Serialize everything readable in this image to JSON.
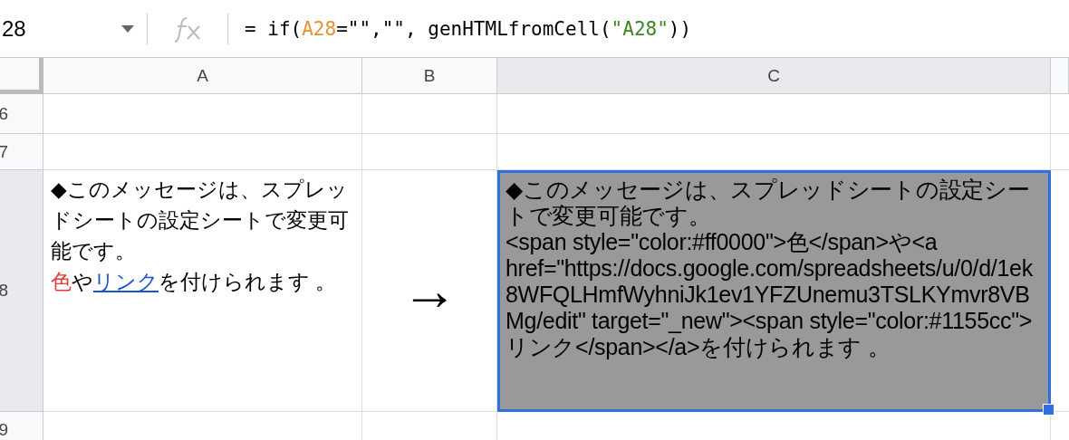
{
  "name_box": {
    "value": "28"
  },
  "formula": [
    {
      "kind": "plain",
      "text": "= if("
    },
    {
      "kind": "ref",
      "text": "A28"
    },
    {
      "kind": "plain",
      "text": "=\"\",\"\", genHTMLfromCell("
    },
    {
      "kind": "string",
      "text": "\"A28\""
    },
    {
      "kind": "plain",
      "text": "))"
    }
  ],
  "columns": [
    {
      "label": "A",
      "selected": false
    },
    {
      "label": "B",
      "selected": false
    },
    {
      "label": "C",
      "selected": true
    }
  ],
  "rows": [
    {
      "label": "6",
      "selected": false
    },
    {
      "label": "7",
      "selected": false
    },
    {
      "label": "8",
      "selected": true,
      "cells": [
        {
          "selected": false,
          "kind": "text",
          "runs": [
            {
              "kind": "plain",
              "text": "◆このメッセージは、スプレッドシートの設定シートで変更可能です。\n"
            },
            {
              "kind": "colored",
              "color": "#e53935",
              "text": "色"
            },
            {
              "kind": "plain",
              "text": "や"
            },
            {
              "kind": "link",
              "text": "リンク"
            },
            {
              "kind": "plain",
              "text": "を付けられます 。"
            }
          ]
        },
        {
          "selected": false,
          "kind": "arrow",
          "runs": [
            {
              "kind": "plain",
              "text": "→"
            }
          ]
        },
        {
          "selected": true,
          "kind": "text",
          "runs": [
            {
              "kind": "plain",
              "text": "◆このメッセージは、スプレッドシートの設定シートで変更可能です。\n<span style=\"color:#ff0000\">色</span>や<a href=\"https://docs.google.com/spreadsheets/u/0/d/1ek8WFQLHmfWyhniJk1ev1YFZUnemu3TSLKYmvr8VBMg/edit\" target=\"_new\"><span style=\"color:#1155cc\">リンク</span></a>を付けられます 。"
            }
          ]
        }
      ]
    },
    {
      "label": "9",
      "selected": false
    }
  ]
}
